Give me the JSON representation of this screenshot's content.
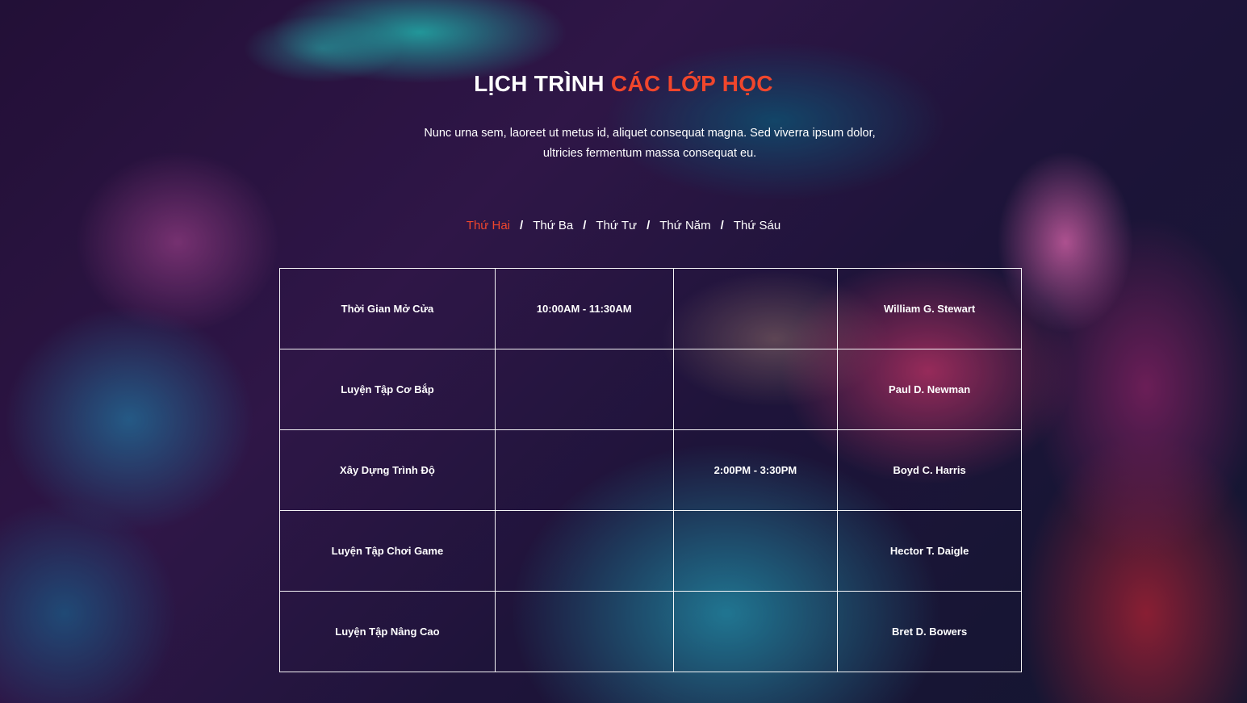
{
  "heading": {
    "part1": "LỊCH TRÌNH",
    "part2": "CÁC LỚP HỌC"
  },
  "subtitle": "Nunc urna sem, laoreet ut metus id, aliquet consequat magna. Sed viverra ipsum dolor, ultricies fermentum massa consequat eu.",
  "tabs": [
    {
      "label": "Thứ Hai",
      "active": true
    },
    {
      "label": "Thứ Ba",
      "active": false
    },
    {
      "label": "Thứ Tư",
      "active": false
    },
    {
      "label": "Thứ Năm",
      "active": false
    },
    {
      "label": "Thứ Sáu",
      "active": false
    }
  ],
  "tab_separator": "/",
  "schedule": [
    {
      "class_name": "Thời Gian Mở Cửa",
      "morning": "10:00AM - 11:30AM",
      "afternoon": "",
      "trainer": "William G. Stewart"
    },
    {
      "class_name": "Luyện Tập Cơ Bắp",
      "morning": "",
      "afternoon": "",
      "trainer": "Paul D. Newman"
    },
    {
      "class_name": "Xây Dựng Trình Độ",
      "morning": "",
      "afternoon": "2:00PM - 3:30PM",
      "trainer": "Boyd C. Harris"
    },
    {
      "class_name": "Luyện Tập Chơi Game",
      "morning": "",
      "afternoon": "",
      "trainer": "Hector T. Daigle"
    },
    {
      "class_name": "Luyện Tập Nâng Cao",
      "morning": "",
      "afternoon": "",
      "trainer": "Bret D. Bowers"
    }
  ],
  "colors": {
    "accent": "#f0462c",
    "text": "#ffffff"
  }
}
